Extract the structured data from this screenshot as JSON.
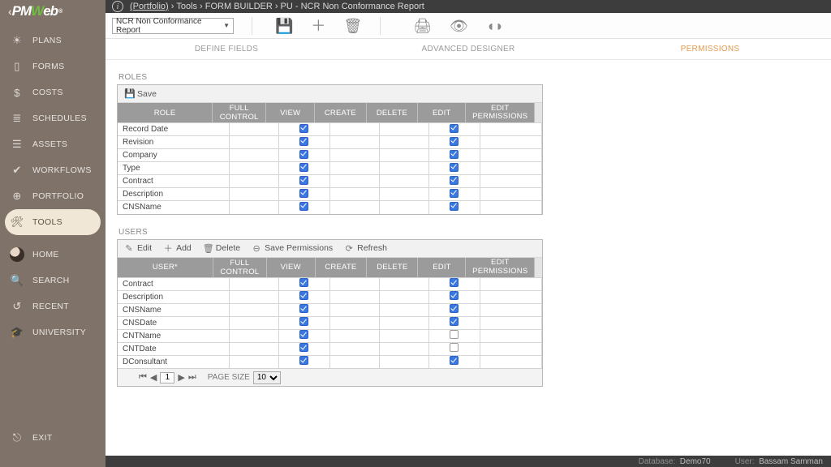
{
  "brand": {
    "pm": "PM",
    "w": "W",
    "eb": "eb",
    "tm": "®"
  },
  "breadcrumb": {
    "root": "(Portfolio)",
    "s1": "Tools",
    "s2": "FORM BUILDER",
    "s3": "PU - NCR Non Conformance Report"
  },
  "toolbar": {
    "dropdown": "NCR Non Conformance Report"
  },
  "tabs": {
    "t1": "DEFINE FIELDS",
    "t2": "ADVANCED DESIGNER",
    "t3": "PERMISSIONS"
  },
  "roles": {
    "label": "ROLES",
    "toolbar": {
      "save": "Save"
    },
    "columns": {
      "role": "ROLE",
      "full": "FULL CONTROL",
      "view": "VIEW",
      "create": "CREATE",
      "delete": "DELETE",
      "edit": "EDIT",
      "editperm": "EDIT PERMISSIONS"
    },
    "rows": [
      {
        "name": "Record Date",
        "view": true,
        "edit": true
      },
      {
        "name": "Revision",
        "view": true,
        "edit": true
      },
      {
        "name": "Company",
        "view": true,
        "edit": true
      },
      {
        "name": "Type",
        "view": true,
        "edit": true
      },
      {
        "name": "Contract",
        "view": true,
        "edit": true
      },
      {
        "name": "Description",
        "view": true,
        "edit": true
      },
      {
        "name": "CNSName",
        "view": true,
        "edit": true
      }
    ]
  },
  "users": {
    "label": "USERS",
    "toolbar": {
      "edit": "Edit",
      "add": "Add",
      "delete": "Delete",
      "saveperm": "Save Permissions",
      "refresh": "Refresh"
    },
    "columns": {
      "user": "USER*",
      "full": "FULL CONTROL",
      "view": "VIEW",
      "create": "CREATE",
      "delete": "DELETE",
      "edit": "EDIT",
      "editperm": "EDIT\nPERMISSIONS"
    },
    "rows": [
      {
        "name": "Contract",
        "view": true,
        "edit": true
      },
      {
        "name": "Description",
        "view": true,
        "edit": true
      },
      {
        "name": "CNSName",
        "view": true,
        "edit": true
      },
      {
        "name": "CNSDate",
        "view": true,
        "edit": true
      },
      {
        "name": "CNTName",
        "view": true,
        "edit": false
      },
      {
        "name": "CNTDate",
        "view": true,
        "edit": false
      },
      {
        "name": "DConsultant",
        "view": true,
        "edit": true
      }
    ],
    "pager": {
      "page": "1",
      "pagesize_label": "PAGE SIZE",
      "pagesize": "10"
    }
  },
  "sidebar": {
    "items": [
      {
        "icon": "bulb",
        "label": "PLANS"
      },
      {
        "icon": "doc",
        "label": "FORMS"
      },
      {
        "icon": "dollar",
        "label": "COSTS"
      },
      {
        "icon": "bars",
        "label": "SCHEDULES"
      },
      {
        "icon": "stack",
        "label": "ASSETS"
      },
      {
        "icon": "check",
        "label": "WORKFLOWS"
      },
      {
        "icon": "globe",
        "label": "PORTFOLIO"
      },
      {
        "icon": "wrench",
        "label": "TOOLS",
        "active": true
      }
    ],
    "lower": [
      {
        "icon": "avatar",
        "label": "HOME"
      },
      {
        "icon": "search",
        "label": "SEARCH"
      },
      {
        "icon": "history",
        "label": "RECENT"
      },
      {
        "icon": "grad",
        "label": "UNIVERSITY"
      }
    ],
    "exit": {
      "label": "EXIT"
    }
  },
  "footer": {
    "db_label": "Database:",
    "db": "Demo70",
    "user_label": "User:",
    "user": "Bassam Samman"
  }
}
